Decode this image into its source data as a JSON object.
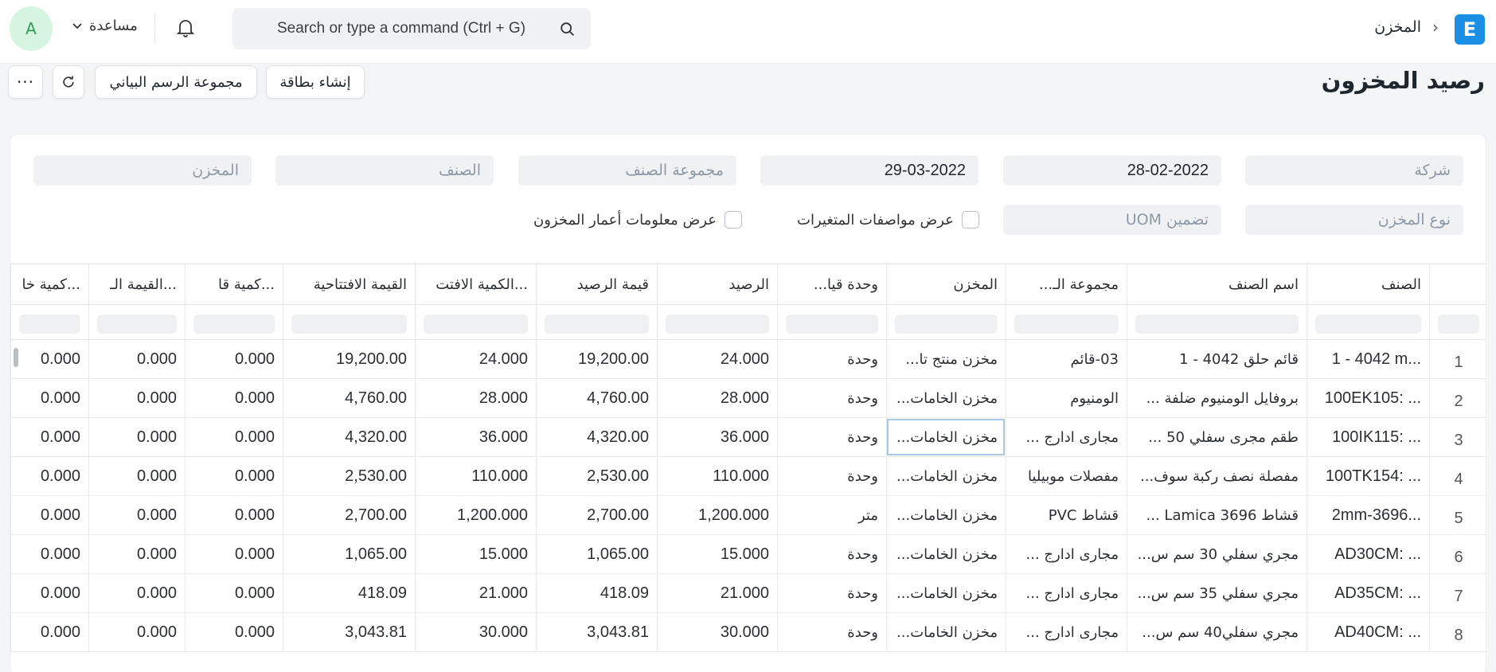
{
  "navbar": {
    "logo": "E",
    "breadcrumb": "المخزن",
    "search_placeholder": "Search or type a command (Ctrl + G)",
    "help_label": "مساعدة",
    "avatar_initial": "A"
  },
  "page": {
    "title": "رصيد المخزون",
    "create_card_label": "إنشاء بطاقة",
    "chart_group_label": "مجموعة الرسم البياني",
    "more_label": "···"
  },
  "filters": {
    "company": "شركة",
    "from_date": "28-02-2022",
    "to_date": "29-03-2022",
    "item_group": "مجموعة الصنف",
    "item": "الصنف",
    "warehouse": "المخزن",
    "warehouse_type": "نوع المخزن",
    "include_uom": "تضمين UOM",
    "show_variant_attributes": "عرض مواصفات المتغيرات",
    "show_stock_ageing": "عرض معلومات أعمار المخزون"
  },
  "table": {
    "headers": [
      "الصنف",
      "اسم الصنف",
      "مجموعة الـ...",
      "المخزن",
      "وحدة قيا...",
      "الرصيد",
      "قيمة الرصيد",
      "الكمية الافتت...",
      "القيمة الافتتاحية",
      "كمية قا...",
      "القيمة الـ...",
      "كمية خا..."
    ],
    "rows": [
      {
        "idx": "1",
        "item": "1 - 4042 m...",
        "item_name": "قائم حلق 4042 - 1",
        "group": "03-قائم",
        "warehouse": "مخزن منتج تا...",
        "uom": "وحدة",
        "bal_qty": "24.000",
        "bal_val": "19,200.00",
        "open_qty": "24.000",
        "open_val": "19,200.00",
        "in_qty": "0.000",
        "in_val": "0.000",
        "out_qty": "0.000"
      },
      {
        "idx": "2",
        "item": "100EK105: ...",
        "item_name": "بروفايل الومنيوم ضلفة ...",
        "group": "الومنيوم",
        "warehouse": "مخزن الخامات...",
        "uom": "وحدة",
        "bal_qty": "28.000",
        "bal_val": "4,760.00",
        "open_qty": "28.000",
        "open_val": "4,760.00",
        "in_qty": "0.000",
        "in_val": "0.000",
        "out_qty": "0.000"
      },
      {
        "idx": "3",
        "item": "100IK115: ...",
        "item_name": "طقم مجرى سفلي 50 ...",
        "group": "مجارى ادارج ...",
        "warehouse": "مخزن الخامات...",
        "uom": "وحدة",
        "bal_qty": "36.000",
        "bal_val": "4,320.00",
        "open_qty": "36.000",
        "open_val": "4,320.00",
        "in_qty": "0.000",
        "in_val": "0.000",
        "out_qty": "0.000"
      },
      {
        "idx": "4",
        "item": "100TK154: ...",
        "item_name": "مفصلة نصف ركبة سوف...",
        "group": "مفصلات موبيليا",
        "warehouse": "مخزن الخامات...",
        "uom": "وحدة",
        "bal_qty": "110.000",
        "bal_val": "2,530.00",
        "open_qty": "110.000",
        "open_val": "2,530.00",
        "in_qty": "0.000",
        "in_val": "0.000",
        "out_qty": "0.000"
      },
      {
        "idx": "5",
        "item": "2mm-3696...",
        "item_name": "قشاط Lamica 3696 ...",
        "group": "قشاط PVC",
        "warehouse": "مخزن الخامات...",
        "uom": "متر",
        "bal_qty": "1,200.000",
        "bal_val": "2,700.00",
        "open_qty": "1,200.000",
        "open_val": "2,700.00",
        "in_qty": "0.000",
        "in_val": "0.000",
        "out_qty": "0.000"
      },
      {
        "idx": "6",
        "item": "AD30CM: ...",
        "item_name": "مجري سفلي 30 سم س...",
        "group": "مجارى ادارج ...",
        "warehouse": "مخزن الخامات...",
        "uom": "وحدة",
        "bal_qty": "15.000",
        "bal_val": "1,065.00",
        "open_qty": "15.000",
        "open_val": "1,065.00",
        "in_qty": "0.000",
        "in_val": "0.000",
        "out_qty": "0.000"
      },
      {
        "idx": "7",
        "item": "AD35CM: ...",
        "item_name": "مجري سفلي 35 سم س...",
        "group": "مجارى ادارج ...",
        "warehouse": "مخزن الخامات...",
        "uom": "وحدة",
        "bal_qty": "21.000",
        "bal_val": "418.09",
        "open_qty": "21.000",
        "open_val": "418.09",
        "in_qty": "0.000",
        "in_val": "0.000",
        "out_qty": "0.000"
      },
      {
        "idx": "8",
        "item": "AD40CM: ...",
        "item_name": "مجري سفلي40 سم س...",
        "group": "مجارى ادارج ...",
        "warehouse": "مخزن الخامات...",
        "uom": "وحدة",
        "bal_qty": "30.000",
        "bal_val": "3,043.81",
        "open_qty": "30.000",
        "open_val": "3,043.81",
        "in_qty": "0.000",
        "in_val": "0.000",
        "out_qty": "0.000"
      }
    ]
  }
}
